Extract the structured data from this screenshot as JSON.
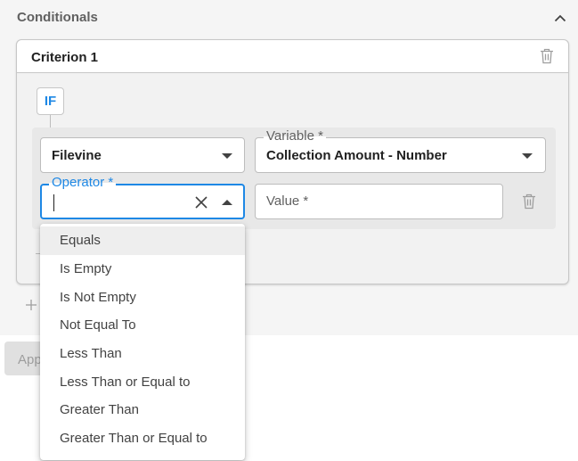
{
  "section": {
    "title": "Conditionals"
  },
  "criterion": {
    "title": "Criterion 1",
    "if_label": "IF"
  },
  "fields": {
    "source": {
      "value": "Filevine"
    },
    "variable": {
      "label": "Variable *",
      "value": "Collection Amount - Number"
    },
    "operator": {
      "label": "Operator *",
      "value": ""
    },
    "value": {
      "placeholder": "Value *"
    }
  },
  "apply": {
    "label": "App"
  },
  "dropdown": {
    "highlighted_index": 0,
    "options": [
      "Equals",
      "Is Empty",
      "Is Not Empty",
      "Not Equal To",
      "Less Than",
      "Less Than or Equal to",
      "Greater Than",
      "Greater Than or Equal to"
    ]
  },
  "colors": {
    "accent": "#1e88e5",
    "panel_bg": "#f5f5f5",
    "text": "#212121"
  },
  "icons": [
    "chevron-up-icon",
    "trash-icon",
    "close-icon",
    "caret-down-icon",
    "caret-up-icon",
    "plus-icon"
  ]
}
